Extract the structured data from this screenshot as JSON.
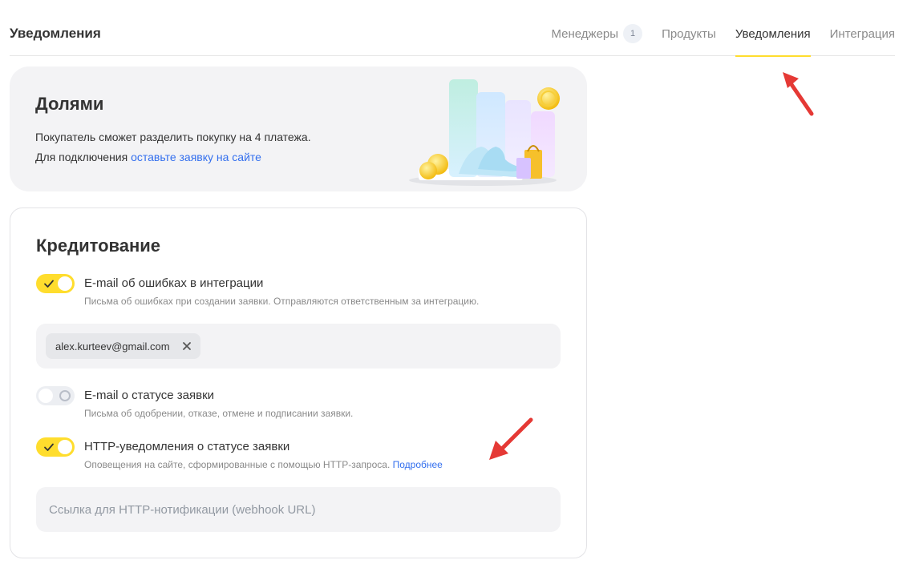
{
  "header": {
    "title": "Уведомления",
    "tabs": [
      {
        "label": "Менеджеры",
        "badge": "1"
      },
      {
        "label": "Продукты"
      },
      {
        "label": "Уведомления",
        "active": true
      },
      {
        "label": "Интеграция"
      }
    ]
  },
  "promo": {
    "title": "Долями",
    "line1": "Покупатель сможет разделить покупку на 4 платежа.",
    "line2_prefix": "Для подключения ",
    "line2_link": "оставьте заявку на сайте"
  },
  "credit": {
    "title": "Кредитование",
    "settings": [
      {
        "label": "E-mail об ошибках в интеграции",
        "description": "Письма об ошибках при создании заявки. Отправляются ответственным за интеграцию.",
        "enabled": true
      },
      {
        "label": "E-mail о статусе заявки",
        "description": "Письма об одобрении, отказе, отмене и подписании заявки.",
        "enabled": false
      },
      {
        "label": "HTTP-уведомления о статусе заявки",
        "description": "Оповещения на сайте, сформированные с помощью HTTP-запроса.",
        "link": "Подробнее",
        "enabled": true
      }
    ],
    "email_chip": "alex.kurteev@gmail.com",
    "webhook_placeholder": "Ссылка для HTTP-нотификации (webhook URL)"
  },
  "colors": {
    "accent_yellow": "#ffdd2d",
    "link_blue": "#336fee",
    "annotation_red": "#e53935"
  }
}
